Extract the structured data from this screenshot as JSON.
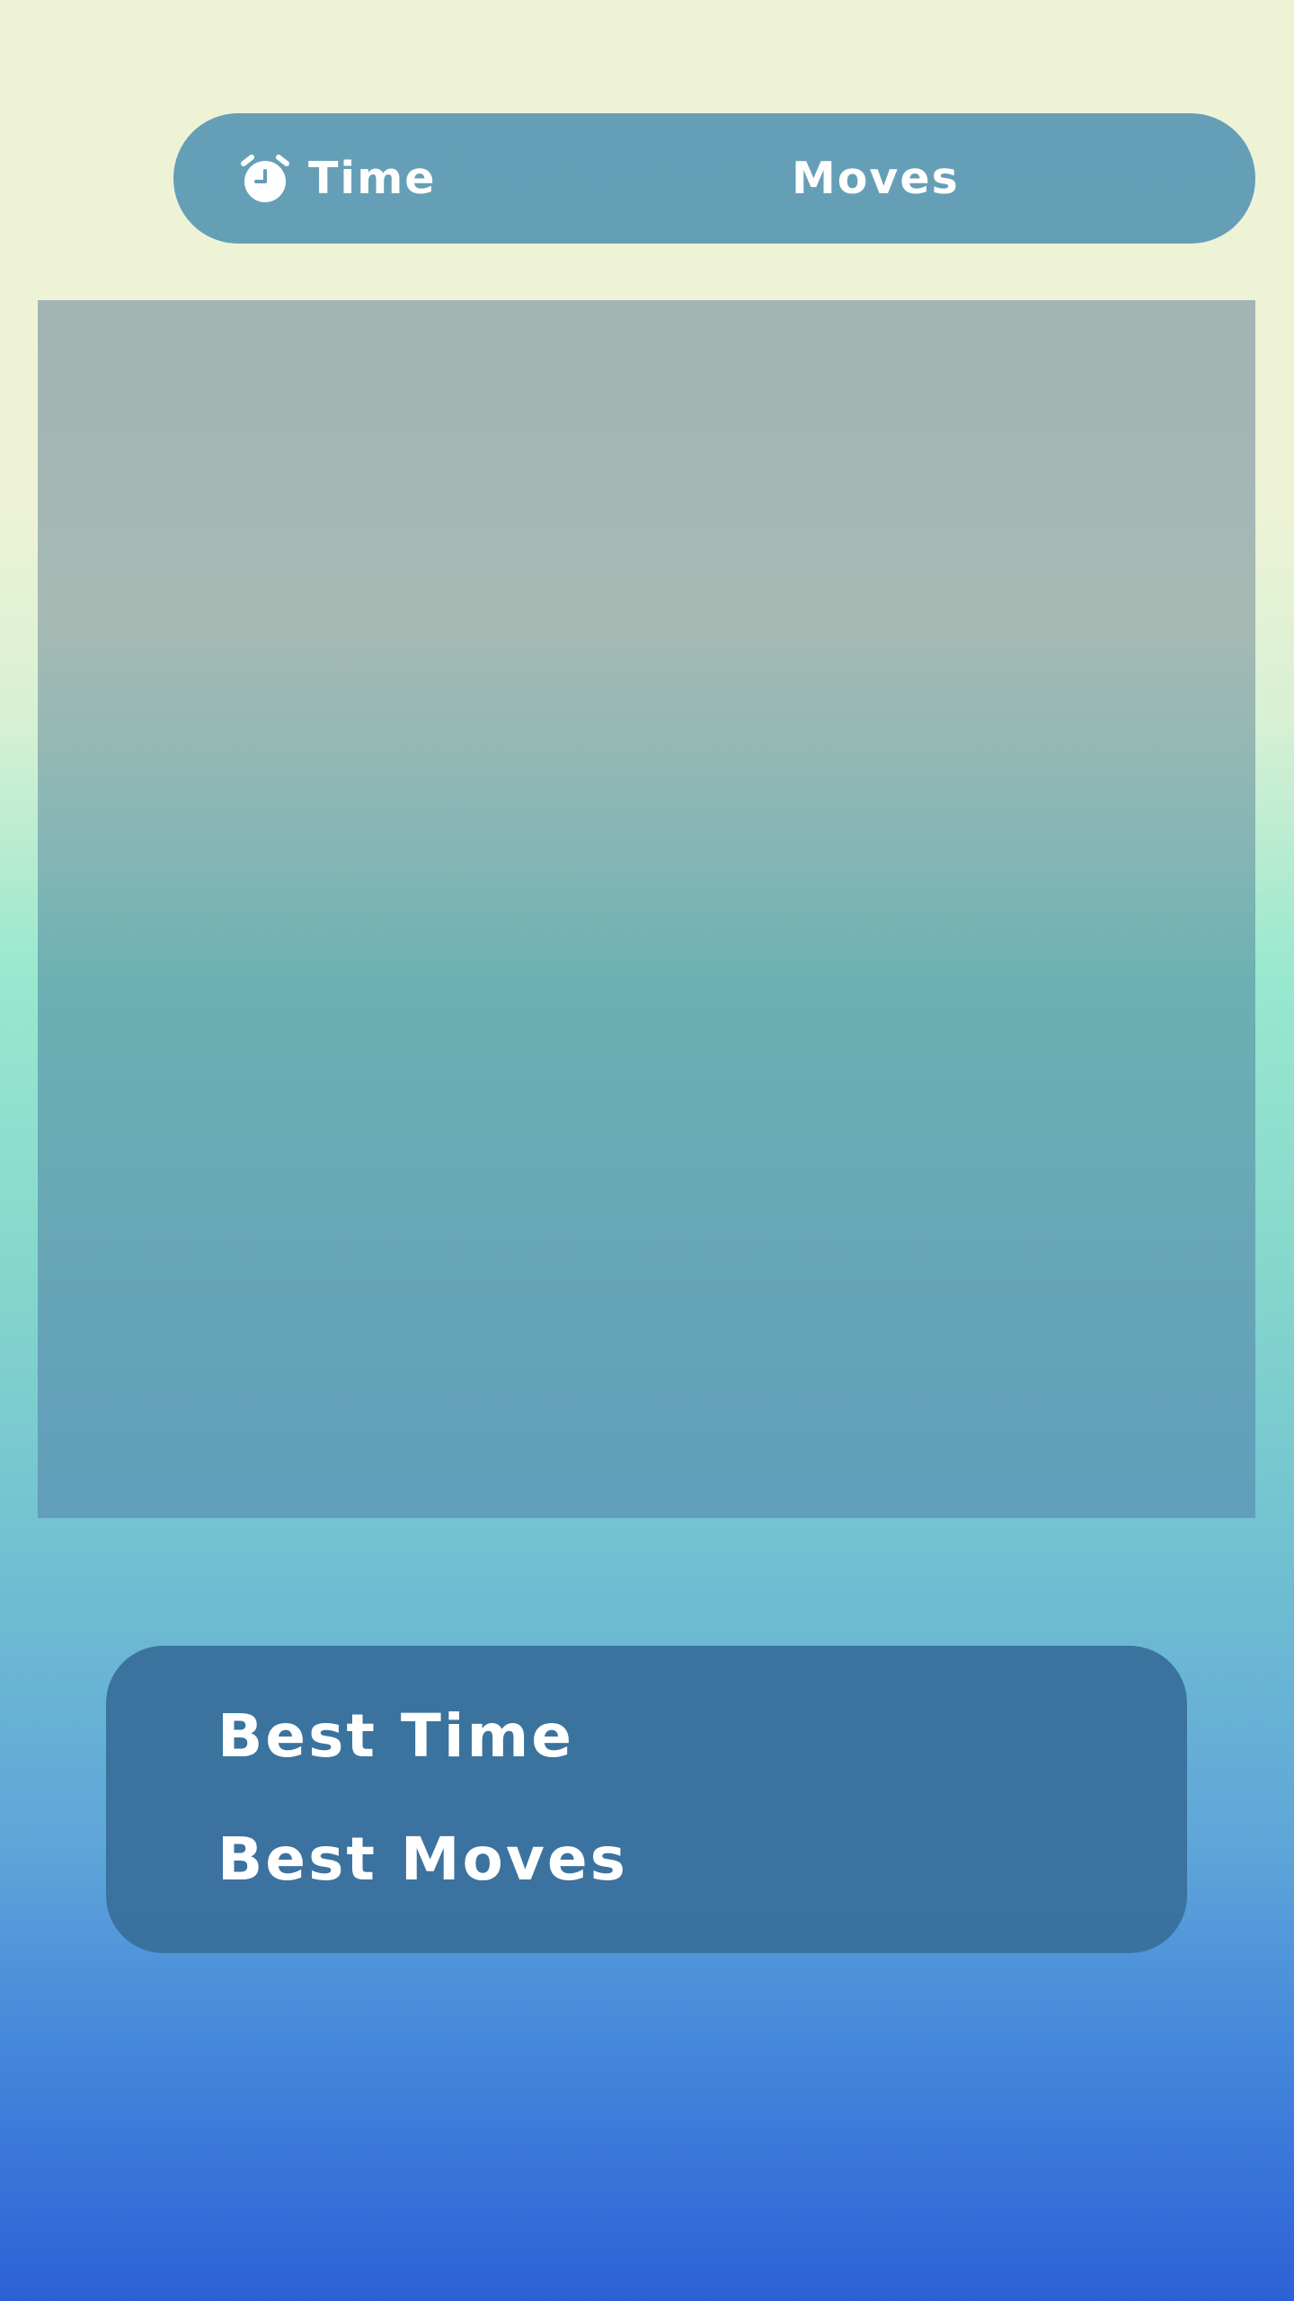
{
  "stats": {
    "time_label": "Time",
    "moves_label": "Moves",
    "time_icon": "alarm-clock-icon"
  },
  "best": {
    "time_label": "Best Time",
    "moves_label": "Best Moves"
  },
  "colors": {
    "stats_bar": "#629db6",
    "board_top": "#a4b6b2",
    "board_mid": "#6cafb2",
    "best_panel": "#3a719d",
    "text": "#ffffff"
  }
}
